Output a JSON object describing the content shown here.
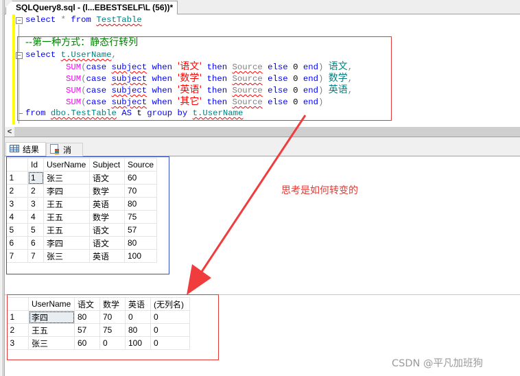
{
  "editor_tab": {
    "title": "SQLQuery8.sql - (l...EBESTSELF\\L (56))*"
  },
  "code": {
    "line1": {
      "select": "select",
      "star": " * ",
      "from": "from",
      "table": "TestTable"
    },
    "comment": "--第一种方式：静态行转列",
    "line_select": {
      "select": "select",
      "col": "t.UserName",
      "comma": ","
    },
    "sum_lines": [
      {
        "fn": "SUM",
        "case": "(case",
        "subject": "subject",
        "when": "when",
        "value": "'语文'",
        "then": "then",
        "source": "Source",
        "else": "else",
        "zero": "0",
        "end": "end)",
        "alias": "语文",
        "comma": ","
      },
      {
        "fn": "SUM",
        "case": "(case",
        "subject": "subject",
        "when": "when",
        "value": "'数学'",
        "then": "then",
        "source": "Source",
        "else": "else",
        "zero": "0",
        "end": "end)",
        "alias": "数学",
        "comma": ","
      },
      {
        "fn": "SUM",
        "case": "(case",
        "subject": "subject",
        "when": "when",
        "value": "'英语'",
        "then": "then",
        "source": "Source",
        "else": "else",
        "zero": "0",
        "end": "end)",
        "alias": "英语",
        "comma": ","
      },
      {
        "fn": "SUM",
        "case": "(case",
        "subject": "subject",
        "when": "when",
        "value": "'其它'",
        "then": "then",
        "source": "Source",
        "else": "else",
        "zero": "0",
        "end": "end)",
        "alias": "",
        "comma": ""
      }
    ],
    "line_from": {
      "from": "from",
      "table": "dbo.TestTable",
      "as": "AS",
      "t": "t",
      "group": "group",
      "by": "by",
      "col": "t.UserName"
    }
  },
  "scrollbar": {
    "left_arrow": "<"
  },
  "result_tabs": [
    {
      "label": "结果",
      "icon": "grid-icon",
      "active": true
    },
    {
      "label": "消息",
      "icon": "messages-icon",
      "active": false
    }
  ],
  "table1": {
    "headers": [
      "",
      "Id",
      "UserName",
      "Subject",
      "Source"
    ],
    "rows": [
      [
        "1",
        "1",
        "张三",
        "语文",
        "60"
      ],
      [
        "2",
        "2",
        "李四",
        "数学",
        "70"
      ],
      [
        "3",
        "3",
        "王五",
        "英语",
        "80"
      ],
      [
        "4",
        "4",
        "王五",
        "数学",
        "75"
      ],
      [
        "5",
        "5",
        "王五",
        "语文",
        "57"
      ],
      [
        "6",
        "6",
        "李四",
        "语文",
        "80"
      ],
      [
        "7",
        "7",
        "张三",
        "英语",
        "100"
      ]
    ]
  },
  "table2": {
    "headers": [
      "",
      "UserName",
      "语文",
      "数学",
      "英语",
      "(无列名)"
    ],
    "rows": [
      [
        "1",
        "李四",
        "80",
        "70",
        "0",
        "0"
      ],
      [
        "2",
        "王五",
        "57",
        "75",
        "80",
        "0"
      ],
      [
        "3",
        "张三",
        "60",
        "0",
        "100",
        "0"
      ]
    ]
  },
  "annotation": {
    "note": "思考是如何转变的",
    "color": "#e53935"
  },
  "watermark": "CSDN @平凡加班狗"
}
